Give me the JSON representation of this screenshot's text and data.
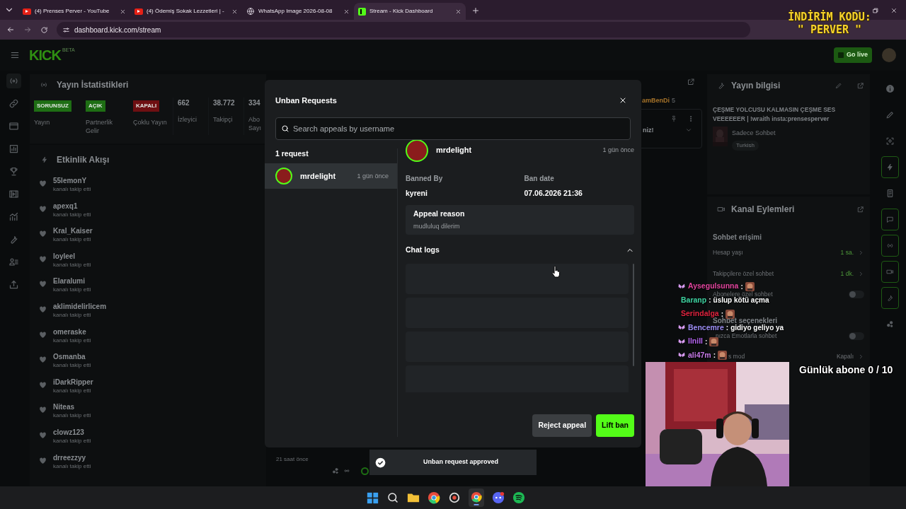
{
  "browser": {
    "tabs": [
      {
        "title": "(4) Prenses Perver - YouTube",
        "selected": false
      },
      {
        "title": "(4) Ödemiş Sokak Lezzetleri | -",
        "selected": false
      },
      {
        "title": "WhatsApp Image 2026-08-08",
        "selected": false
      },
      {
        "title": "Stream - Kick Dashboard",
        "selected": true
      }
    ],
    "url": "dashboard.kick.com/stream"
  },
  "header": {
    "logo": "KICK",
    "logo_tag": "BETA",
    "go_live": "Go live"
  },
  "stats": {
    "title": "Yayın İstatistikleri",
    "badges": [
      {
        "label": "SORUNSUZ",
        "caption": "Yayın",
        "color": "#1e6e14"
      },
      {
        "label": "AÇIK",
        "caption": "Partnerlik Gelir",
        "color": "#1e6e14"
      },
      {
        "label": "KAPALI",
        "caption": "Çoklu Yayın",
        "color": "#6e0f12"
      }
    ],
    "metrics": [
      {
        "value": "662",
        "label": "İzleyici"
      },
      {
        "value": "38.772",
        "label": "Takipçi"
      },
      {
        "value": "334",
        "label": "Abo Sayı"
      }
    ]
  },
  "activity": {
    "title": "Etkinlik Akışı",
    "items": [
      {
        "user": "55lemonY",
        "action": "kanalı takip etti"
      },
      {
        "user": "apexq1",
        "action": "kanalı takip etti"
      },
      {
        "user": "Kral_Kaiser",
        "action": "kanalı takip etti"
      },
      {
        "user": "loyleel",
        "action": "kanalı takip etti"
      },
      {
        "user": "Elaralumi",
        "action": "kanalı takip etti"
      },
      {
        "user": "aklimidelirlicem",
        "action": "kanalı takip etti"
      },
      {
        "user": "omeraske",
        "action": "kanalı takip etti"
      },
      {
        "user": "Osmanba",
        "action": "kanalı takip etti"
      },
      {
        "user": "iDarkRipper",
        "action": "kanalı takip etti"
      },
      {
        "user": "Niteas",
        "action": "kanalı takip etti"
      },
      {
        "user": "clowz123",
        "action": "kanalı takip etti"
      },
      {
        "user": "drreezzyy",
        "action": "kanalı takip etti"
      }
    ]
  },
  "chat_panel": {
    "user": "amBenDi",
    "count": "5",
    "pinned_text": "niz!",
    "time": "21 saat önce"
  },
  "stream_info": {
    "title": "Yayın bilgisi",
    "stream_title": "ÇEŞME YOLCUSU KALMASIN ÇEŞME SES VEEEEEER | !wraith insta:prensesperver",
    "category": "Sadece Sohbet",
    "tag": "Turkish"
  },
  "channel_actions": {
    "title": "Kanal Eylemleri",
    "sections": [
      {
        "heading": "Sohbet erişimi",
        "rows": [
          {
            "label": "Hesap yaşı",
            "kind": "value",
            "value": "1 sa."
          },
          {
            "label": "Takipçilere özel sohbet",
            "kind": "value",
            "value": "1 dk."
          },
          {
            "label": "Abonelere özel sohbet",
            "kind": "toggle",
            "on": false
          }
        ]
      },
      {
        "heading": "Sohbet seçenekleri",
        "rows": [
          {
            "label": "nızca Emotlarla sohbet",
            "kind": "toggle",
            "on": false
          },
          {
            "label": "s mod",
            "kind": "value",
            "value": "Kapalı"
          }
        ]
      }
    ]
  },
  "modal": {
    "title": "Unban Requests",
    "search": {
      "placeholder": "Search appeals by username"
    },
    "count": "1 request",
    "requests": [
      {
        "user": "mrdelight",
        "time": "1 gün önce",
        "selected": true
      }
    ],
    "detail": {
      "user": "mrdelight",
      "time": "1 gün önce",
      "banned_by_label": "Banned By",
      "banned_by": "kyreni",
      "ban_date_label": "Ban date",
      "ban_date": "07.06.2026 21:36",
      "reason_label": "Appeal reason",
      "reason": "mudluluq dilerim",
      "chat_logs": "Chat logs",
      "chat_logs_expanded": true
    },
    "buttons": {
      "reject": "Reject appeal",
      "lift": "Lift ban"
    }
  },
  "toast": "Unban request approved",
  "stream_overlay": {
    "promo": [
      "İNDİRİM KODU:",
      "\" PERVER \""
    ],
    "sub_goal": "Günlük abone 0 / 10",
    "chat": [
      {
        "user": "Aysegulsunna",
        "color": "#e2459e",
        "badge": true,
        "colon": ":",
        "kind": "emote"
      },
      {
        "user": "Baranp",
        "color": "#3fd4a2",
        "badge": false,
        "colon": ":",
        "kind": "text",
        "text": "üslup kötü açma"
      },
      {
        "user": "Serindalga",
        "color": "#e0233f",
        "badge": false,
        "colon": ":",
        "kind": "emote"
      },
      {
        "user": "Bencemre",
        "color": "#9d8ef5",
        "badge": true,
        "colon": ":",
        "kind": "text",
        "text": "gidiyo geliyo ya"
      },
      {
        "user": "llnill",
        "color": "#b565f0",
        "badge": true,
        "colon": ":",
        "kind": "emote"
      },
      {
        "user": "ali47m",
        "color": "#c77ae8",
        "badge": true,
        "colon": ":",
        "kind": "emote"
      }
    ]
  }
}
